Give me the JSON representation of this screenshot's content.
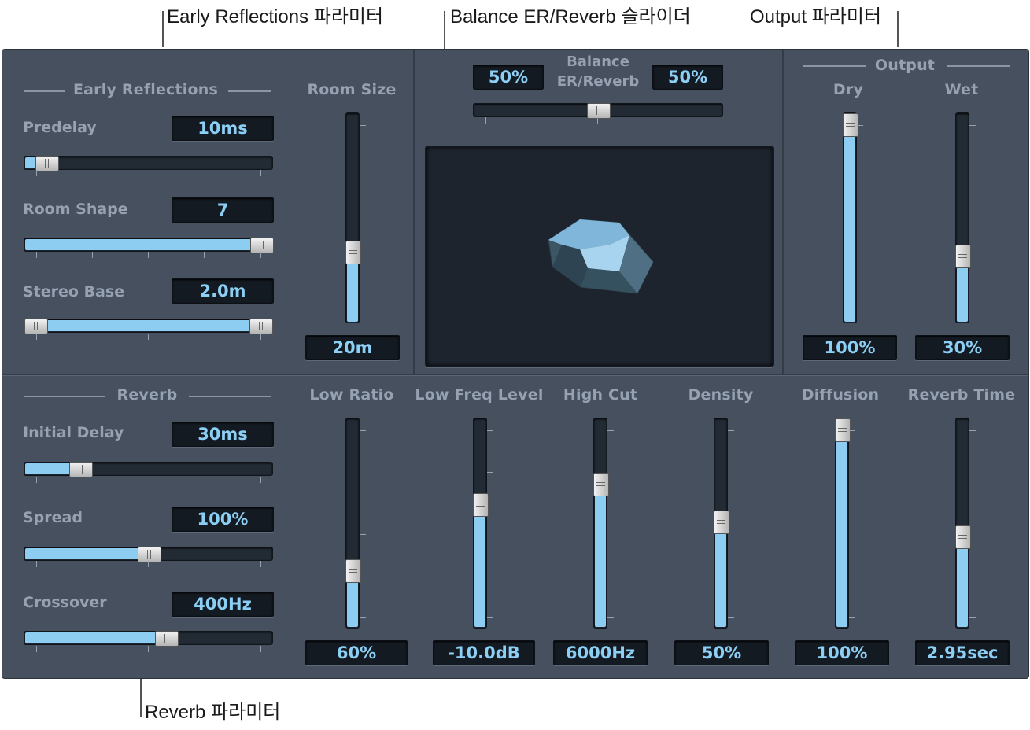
{
  "callouts": {
    "early_reflections": "Early Reflections 파라미터",
    "balance": "Balance ER/Reverb 슬라이더",
    "output": "Output 파라미터",
    "reverb": "Reverb 파라미터"
  },
  "early_reflections": {
    "title": "Early Reflections",
    "predelay": {
      "label": "Predelay",
      "value": "10ms",
      "level": 0.05
    },
    "room_shape": {
      "label": "Room Shape",
      "value": "7",
      "level": 1.0
    },
    "stereo_base": {
      "label": "Stereo Base",
      "value": "2.0m",
      "level_min": 0.0,
      "level_max": 1.0
    },
    "room_size": {
      "label": "Room Size",
      "value": "20m",
      "level": 0.32
    }
  },
  "balance": {
    "label_line1": "Balance",
    "label_line2": "ER/Reverb",
    "er_value": "50%",
    "reverb_value": "50%",
    "level": 0.5
  },
  "output": {
    "title": "Output",
    "dry": {
      "label": "Dry",
      "value": "100%",
      "level": 1.0
    },
    "wet": {
      "label": "Wet",
      "value": "30%",
      "level": 0.3
    }
  },
  "reverb": {
    "title": "Reverb",
    "initial_delay": {
      "label": "Initial Delay",
      "value": "30ms",
      "level": 0.2
    },
    "spread": {
      "label": "Spread",
      "value": "100%",
      "level": 0.5
    },
    "crossover": {
      "label": "Crossover",
      "value": "400Hz",
      "level": 0.58
    },
    "low_ratio": {
      "label": "Low Ratio",
      "value": "60%",
      "level": 0.25
    },
    "low_freq_level": {
      "label": "Low Freq Level",
      "value": "-10.0dB",
      "level": 0.6
    },
    "high_cut": {
      "label": "High Cut",
      "value": "6000Hz",
      "level": 0.71
    },
    "density": {
      "label": "Density",
      "value": "50%",
      "level": 0.51
    },
    "diffusion": {
      "label": "Diffusion",
      "value": "100%",
      "level": 1.0
    },
    "reverb_time": {
      "label": "Reverb Time",
      "value": "2.95sec",
      "level": 0.43
    }
  },
  "colors": {
    "panel": "#46505f",
    "value_text": "#8ccff5",
    "slider_fill": "#8ccdf1",
    "label_text": "#96a1b1"
  }
}
